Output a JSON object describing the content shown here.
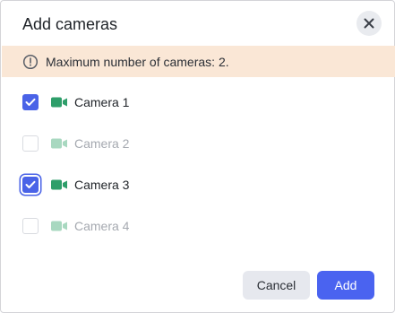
{
  "dialog": {
    "title": "Add cameras",
    "close_icon": "close-icon"
  },
  "banner": {
    "icon": "info-icon",
    "message": "Maximum number of cameras: 2."
  },
  "cameras": [
    {
      "label": "Camera 1",
      "checked": true,
      "enabled": true
    },
    {
      "label": "Camera 2",
      "checked": false,
      "enabled": false
    },
    {
      "label": "Camera 3",
      "checked": true,
      "enabled": true,
      "focused": true
    },
    {
      "label": "Camera 4",
      "checked": false,
      "enabled": false
    }
  ],
  "footer": {
    "cancel_label": "Cancel",
    "add_label": "Add"
  },
  "colors": {
    "accent": "#4a63f0",
    "banner_bg": "#fae7d6",
    "camera_icon_enabled": "#2e9e6a",
    "camera_icon_disabled": "#a8d8c0"
  }
}
